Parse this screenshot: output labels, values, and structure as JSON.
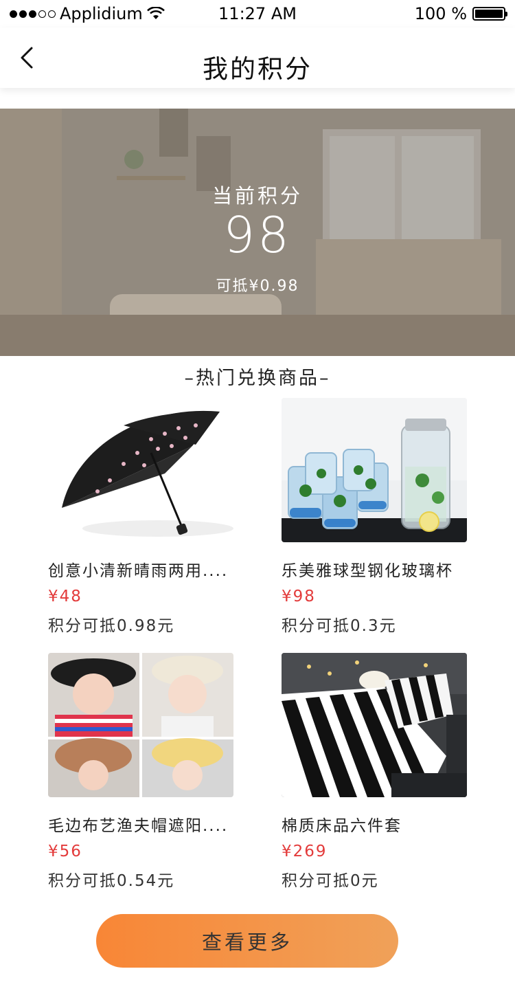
{
  "status_bar": {
    "carrier": "Applidium",
    "time": "11:27 AM",
    "battery": "100 %"
  },
  "nav": {
    "title": "我的积分",
    "back_icon": "chevron-left-icon"
  },
  "points": {
    "label": "当前积分",
    "value": "98",
    "worth": "可抵¥0.98"
  },
  "section_title": "–热门兑换商品–",
  "products": [
    {
      "name": "创意小清新晴雨两用....",
      "price": "¥48",
      "deduct": "积分可抵0.98元",
      "image": "umbrella"
    },
    {
      "name": "乐美雅球型钢化玻璃杯",
      "price": "¥98",
      "deduct": "积分可抵0.3元",
      "image": "glass-pitcher"
    },
    {
      "name": "毛边布艺渔夫帽遮阳....",
      "price": "¥56",
      "deduct": "积分可抵0.54元",
      "image": "kids-hats"
    },
    {
      "name": "棉质床品六件套",
      "price": "¥269",
      "deduct": "积分可抵0元",
      "image": "striped-bedding"
    }
  ],
  "more_button": "查看更多",
  "colors": {
    "price": "#e33b3b",
    "button_start": "#f88636",
    "button_end": "#f0a159"
  }
}
